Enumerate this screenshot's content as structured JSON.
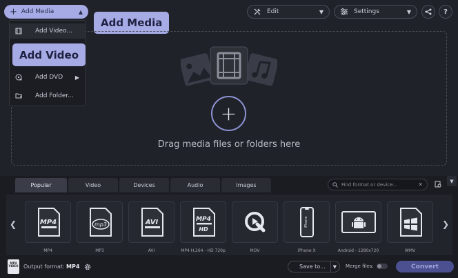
{
  "toolbar": {
    "add_media_label": "Add Media",
    "edit_label": "Edit",
    "settings_label": "Settings",
    "help_label": "?"
  },
  "callouts": {
    "add_media": "Add Media",
    "add_video": "Add Video"
  },
  "add_menu": {
    "items": [
      {
        "label": "Add Video..."
      },
      {
        "label": "Add DVD"
      },
      {
        "label": "Add Folder..."
      }
    ]
  },
  "drop_area": {
    "text": "Drag media files or folders here"
  },
  "format_panel": {
    "tabs": [
      "Popular",
      "Video",
      "Devices",
      "Audio",
      "Images"
    ],
    "active_tab": "Popular",
    "search_placeholder": "Find format or device...",
    "formats": [
      {
        "label": "MP4",
        "badge": "MP4"
      },
      {
        "label": "MP3",
        "badge": "mp3"
      },
      {
        "label": "AVI",
        "badge": "AVI"
      },
      {
        "label": "MP4 H.264 - HD 720p",
        "badge": "MP4",
        "badge_sub": "HD"
      },
      {
        "label": "MOV",
        "badge": ""
      },
      {
        "label": "iPhone X",
        "badge": "iPhone"
      },
      {
        "label": "Android - 1280x720",
        "badge": ""
      },
      {
        "label": "WMV",
        "badge": ""
      }
    ]
  },
  "footer": {
    "file_icon_text": "MP4 VIDEO",
    "output_format_label": "Output format:",
    "output_format_value": "MP4",
    "save_to_label": "Save to...",
    "merge_label": "Merge files:",
    "merge_enabled": false,
    "convert_label": "Convert"
  },
  "colors": {
    "accent": "#a6abe6",
    "background": "#202229",
    "panel": "#1a1c22",
    "convert_button": "#4c5090"
  }
}
